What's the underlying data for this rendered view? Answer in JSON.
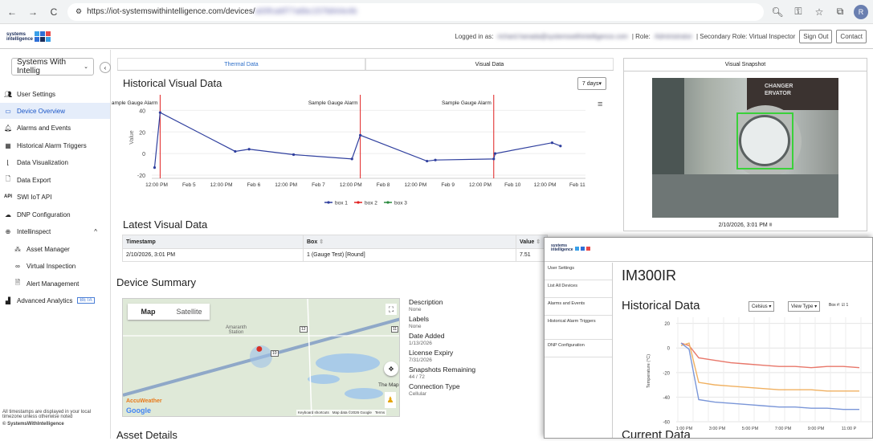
{
  "browser": {
    "url_prefix": "https://iot-systemswithintelligence.com/devices/",
    "url_hidden": "a00fca6f77a6bc157b844e4b",
    "back_icon": "back-arrow-icon",
    "forward_icon": "forward-arrow-icon",
    "reload_icon": "reload-icon",
    "profile_initial": "R"
  },
  "header": {
    "logo_text_1": "systems",
    "logo_text_2": "intelligence",
    "logged_in_label": "Logged in as:",
    "logged_in_user": "richard.hanada@systemswithintelligence.com",
    "role_label": "| Role:",
    "role_value": "Administrator",
    "secondary_role": "| Secondary Role: Virtual Inspector",
    "signout": "Sign Out",
    "contact": "Contact",
    "colors": {
      "blue": "#2f6fd6",
      "navy": "#1b2d5a",
      "red": "#e84a4a",
      "cyan": "#3aa0e8"
    }
  },
  "sidebar": {
    "org_selector": "Systems With Intellig",
    "collapse_icon": "chevron-left-icon",
    "items": [
      {
        "label": "User Settings",
        "icon": "users-icon"
      },
      {
        "label": "Device Overview",
        "icon": "devices-icon"
      },
      {
        "label": "Alarms and Events",
        "icon": "bell-icon"
      },
      {
        "label": "Historical Alarm Triggers",
        "icon": "calendar-icon"
      },
      {
        "label": "Data Visualization",
        "icon": "chart-icon"
      },
      {
        "label": "Data Export",
        "icon": "file-icon"
      },
      {
        "label": "SWI IoT API",
        "icon": "api-icon"
      },
      {
        "label": "DNP Configuration",
        "icon": "cloud-icon"
      },
      {
        "label": "Intellinspect",
        "icon": "magnifier-icon"
      },
      {
        "label": "Asset Manager",
        "icon": "hierarchy-icon"
      },
      {
        "label": "Virtual Inspection",
        "icon": "binoculars-icon"
      },
      {
        "label": "Alert Management",
        "icon": "alert-doc-icon"
      },
      {
        "label": "Advanced Analytics",
        "icon": "analytics-icon"
      }
    ],
    "beta": "BETA",
    "footer_note": "All timestamps are displayed in your local timezone unless otherwise noted",
    "copyright": "© SystemsWithIntelligence"
  },
  "main": {
    "tabs": [
      "Thermal Data",
      "Visual Data"
    ],
    "historical_title": "Historical Visual Data",
    "range_select": "7 days",
    "latest_title": "Latest Visual Data",
    "table_headers": [
      "Timestamp",
      "Box",
      "Value"
    ],
    "table_rows": [
      [
        "2/10/2026, 3:01 PM",
        "1 (Gauge Test) [Round]",
        "7.51"
      ]
    ],
    "device_summary_title": "Device Summary",
    "asset_details_title": "Asset Details",
    "map": {
      "tab_map": "Map",
      "tab_satellite": "Satellite",
      "place1": "Amaranth",
      "place2": "Station",
      "place3": "The Map",
      "road1": "12",
      "road2": "10",
      "road3": "11",
      "shortcut_text": "Keyboard shortcuts",
      "map_data_text": "Map data ©2026 Google",
      "terms": "Terms",
      "google": "Google",
      "accuweather": "AccuWeather"
    },
    "device_info": [
      {
        "label": "Description",
        "value": "None"
      },
      {
        "label": "Labels",
        "value": "None"
      },
      {
        "label": "Date Added",
        "value": "1/13/2026"
      },
      {
        "label": "License Expiry",
        "value": "7/31/2026"
      },
      {
        "label": "Snapshots Remaining",
        "value": "44 / 72"
      },
      {
        "label": "Connection Type",
        "value": "Cellular"
      }
    ]
  },
  "snapshot": {
    "title": "Visual Snapshot",
    "caption": "2/10/2026, 3:01 PM",
    "sign_line1": "CHANGER",
    "sign_line2": "ERVATOR"
  },
  "chart_data": {
    "type": "line",
    "title": "",
    "ylabel": "Value",
    "ylim": [
      -20,
      50
    ],
    "yticks": [
      40,
      20,
      0,
      -20
    ],
    "xtick_labels": [
      "12:00 PM",
      "Feb 5",
      "12:00 PM",
      "Feb 6",
      "12:00 PM",
      "Feb 7",
      "12:00 PM",
      "Feb 8",
      "12:00 PM",
      "Feb 9",
      "12:00 PM",
      "Feb 10",
      "12:00 PM",
      "Feb 11"
    ],
    "x_domain": [
      "2026-02-04T12:00",
      "2026-02-11T00:00"
    ],
    "annotations": [
      {
        "x": "2026-02-04T15:00",
        "label": "Sample Gauge Alarm",
        "color": "#e02020"
      },
      {
        "x": "2026-02-07T15:00",
        "label": "Sample Gauge Alarm",
        "color": "#e02020"
      },
      {
        "x": "2026-02-09T15:00",
        "label": "Sample Gauge Alarm",
        "color": "#e02020"
      }
    ],
    "series": [
      {
        "name": "box 1",
        "color": "#2f3f9e",
        "points": [
          [
            "2026-02-04T13:00",
            -13
          ],
          [
            "2026-02-04T15:00",
            38
          ],
          [
            "2026-02-05T18:00",
            2
          ],
          [
            "2026-02-05T23:00",
            4
          ],
          [
            "2026-02-06T15:00",
            -1
          ],
          [
            "2026-02-07T12:00",
            -5
          ],
          [
            "2026-02-07T15:00",
            17
          ],
          [
            "2026-02-08T15:00",
            -7
          ],
          [
            "2026-02-08T18:00",
            -6
          ],
          [
            "2026-02-09T15:00",
            -5
          ],
          [
            "2026-02-09T15:30",
            0
          ],
          [
            "2026-02-10T12:00",
            10
          ],
          [
            "2026-02-10T15:00",
            7
          ]
        ]
      },
      {
        "name": "box 2",
        "color": "#e02020",
        "points": []
      },
      {
        "name": "box 3",
        "color": "#2b8a3e",
        "points": []
      }
    ],
    "legend_position": "bottom",
    "menu_icon": "hamburger-icon"
  },
  "popup": {
    "title": "IM300IR",
    "historical_title": "Historical Data",
    "unit_select": "Celsius",
    "view_select": "View Type",
    "box_label": "Box #:",
    "box_value": "1",
    "current_title": "Current Data",
    "nav": [
      "User Settings",
      "List All Devices",
      "Alarms and Events",
      "Historical Alarm Triggers",
      "DNP Configuration"
    ],
    "chart_data": {
      "type": "line",
      "ylabel": "Temperature (°C)",
      "yticks": [
        20,
        0,
        -20,
        -40,
        -60
      ],
      "ylim": [
        -60,
        25
      ],
      "xtick_labels": [
        "1:00 PM",
        "3:00 PM",
        "5:00 PM",
        "7:00 PM",
        "9:00 PM",
        "11:00 P"
      ],
      "series": [
        {
          "color": "#e8776a",
          "values": [
            4,
            2,
            -8,
            -10,
            -12,
            -13,
            -14,
            -15,
            -15,
            -16,
            -15,
            -15,
            -16
          ]
        },
        {
          "color": "#f0b060",
          "values": [
            2,
            4,
            -28,
            -30,
            -31,
            -32,
            -33,
            -34,
            -34,
            -34,
            -35,
            -35,
            -35
          ]
        },
        {
          "color": "#7a96d8",
          "values": [
            4,
            -1,
            -42,
            -44,
            -45,
            -46,
            -47,
            -48,
            -48,
            -49,
            -49,
            -50,
            -50
          ]
        }
      ]
    }
  }
}
